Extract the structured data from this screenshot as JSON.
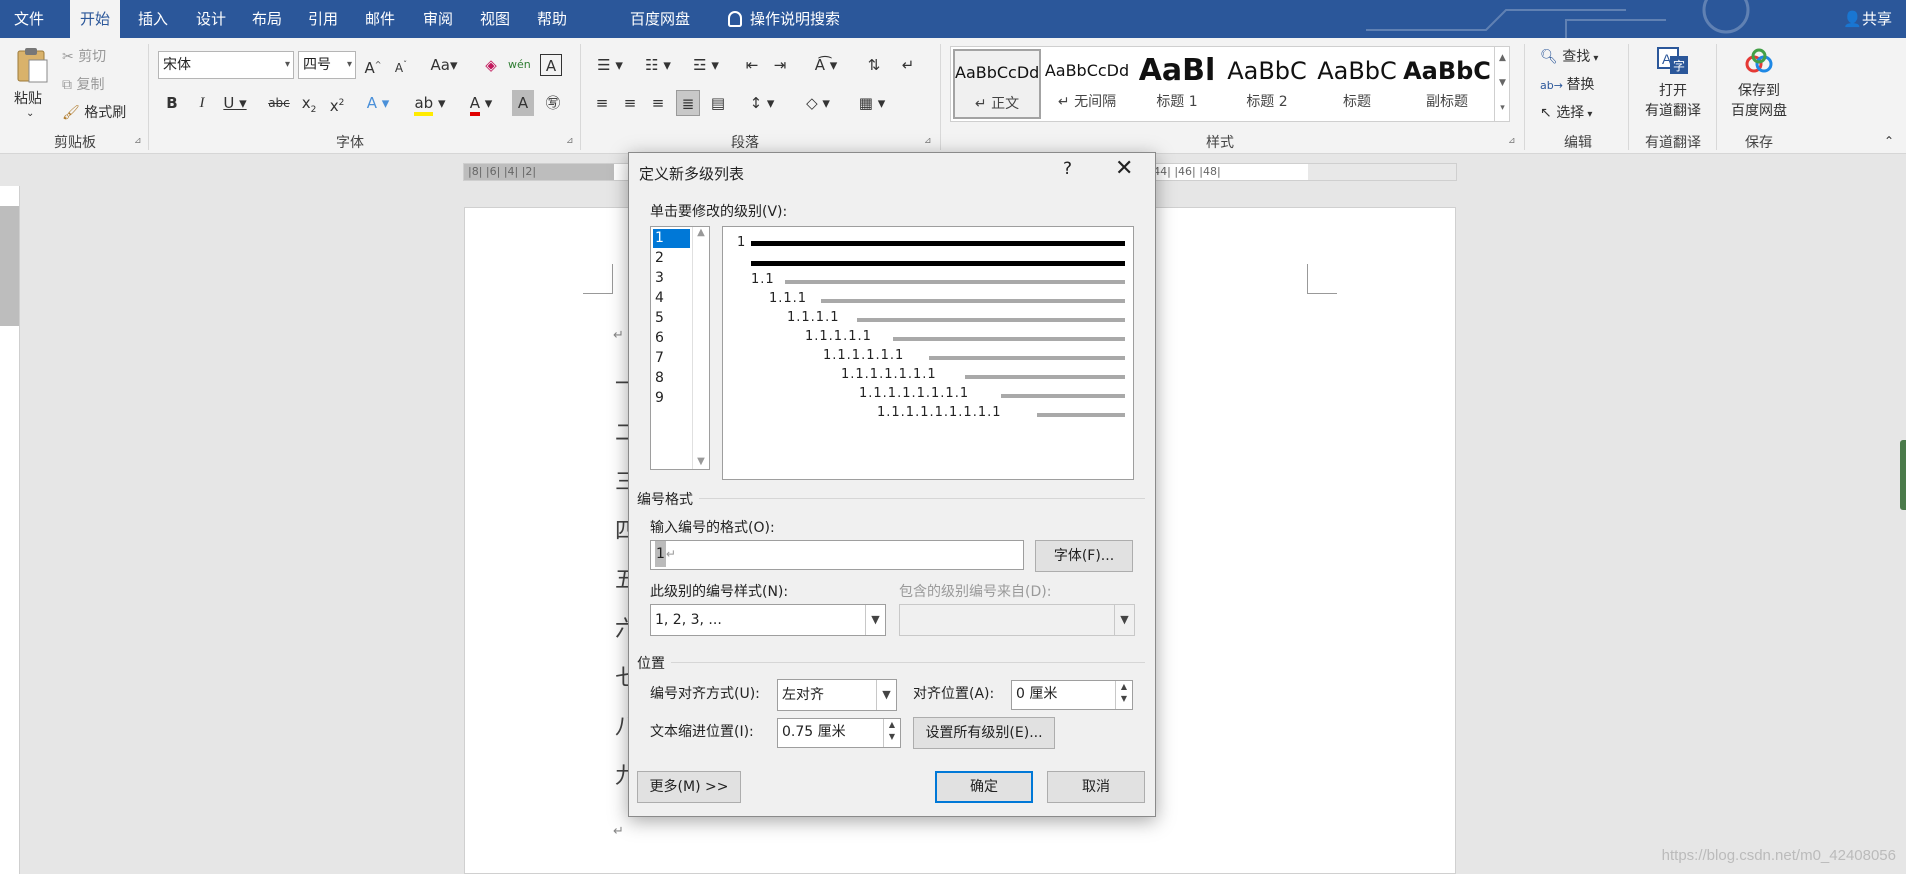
{
  "menu": {
    "tabs": [
      "文件",
      "开始",
      "插入",
      "设计",
      "布局",
      "引用",
      "邮件",
      "审阅",
      "视图",
      "帮助",
      "百度网盘",
      "操作说明搜索"
    ],
    "active_index": 1,
    "share": "共享"
  },
  "ribbon": {
    "clipboard": {
      "paste": "粘贴",
      "cut": "剪切",
      "copy": "复制",
      "format_painter": "格式刷",
      "label": "剪贴板"
    },
    "font": {
      "name": "宋体",
      "size": "四号",
      "label": "字体"
    },
    "paragraph": {
      "label": "段落"
    },
    "styles": {
      "label": "样式",
      "items": [
        {
          "sample": "AaBbCcDd",
          "name": "↵ 正文"
        },
        {
          "sample": "AaBbCcDd",
          "name": "↵ 无间隔"
        },
        {
          "sample": "AaBl",
          "name": "标题 1"
        },
        {
          "sample": "AaBbC",
          "name": "标题 2"
        },
        {
          "sample": "AaBbC",
          "name": "标题"
        },
        {
          "sample": "AaBbC",
          "name": "副标题"
        }
      ]
    },
    "editing": {
      "find": "查找",
      "replace": "替换",
      "select": "选择",
      "label": "编辑"
    },
    "translate": {
      "line1": "打开",
      "line2": "有道翻译",
      "label": "有道翻译"
    },
    "save": {
      "line1": "保存到",
      "line2": "百度网盘",
      "label": "保存"
    }
  },
  "ruler": {
    "text_left": "|8| |6| |4| |2|",
    "text_right": "|32| |34| |36| |38| |40| |42| |44| |46| |48|"
  },
  "document": {
    "chars": [
      "一",
      "二",
      "三",
      "四",
      "五",
      "六",
      "七",
      "八",
      "九"
    ],
    "para_mark": "↵",
    "watermark": "https://blog.csdn.net/m0_42408056"
  },
  "dialog": {
    "title": "定义新多级列表",
    "help": "?",
    "close": "✕",
    "click_level_label": "单击要修改的级别(V):",
    "levels": [
      "1",
      "2",
      "3",
      "4",
      "5",
      "6",
      "7",
      "8",
      "9"
    ],
    "selected_level": 0,
    "preview": [
      "1",
      "",
      "1.1",
      "1.1.1",
      "1.1.1.1",
      "1.1.1.1.1",
      "1.1.1.1.1.1",
      "1.1.1.1.1.1.1",
      "1.1.1.1.1.1.1.1",
      "1.1.1.1.1.1.1.1.1"
    ],
    "number_format_section": "编号格式",
    "enter_format_label": "输入编号的格式(O):",
    "format_value": "1",
    "font_button": "字体(F)...",
    "style_label": "此级别的编号样式(N):",
    "style_value": "1, 2, 3, ...",
    "include_label": "包含的级别编号来自(D):",
    "include_value": "",
    "position_section": "位置",
    "align_label": "编号对齐方式(U):",
    "align_value": "左对齐",
    "aligned_at_label": "对齐位置(A):",
    "aligned_at_value": "0 厘米",
    "indent_label": "文本缩进位置(I):",
    "indent_value": "0.75 厘米",
    "set_all_button": "设置所有级别(E)...",
    "more_button": "更多(M) >>",
    "ok_button": "确定",
    "cancel_button": "取消"
  }
}
